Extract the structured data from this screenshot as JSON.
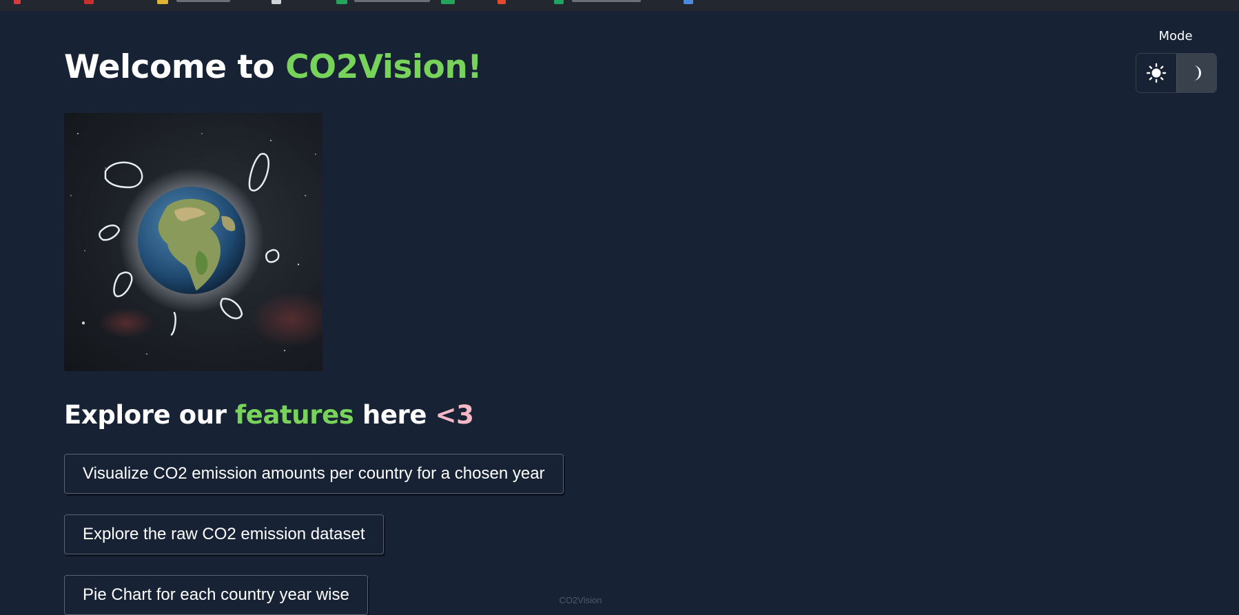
{
  "header": {
    "title_prefix": "Welcome to ",
    "title_brand": "CO2Vision!"
  },
  "mode": {
    "label": "Mode",
    "options": [
      "light",
      "dark"
    ],
    "selected": "dark"
  },
  "hero_image": {
    "icon": "earth-footprints-image"
  },
  "features": {
    "heading_prefix": "Explore our ",
    "heading_highlight": "features",
    "heading_middle": " here ",
    "heading_heart": "<3",
    "buttons": [
      "Visualize CO2 emission amounts per country for a chosen year",
      "Explore the raw CO2 emission dataset",
      "Pie Chart for each country year wise"
    ]
  },
  "footer": {
    "text": "CO2Vision"
  },
  "colors": {
    "background": "#172235",
    "accent_green": "#78d35a",
    "accent_pink": "#f5b8c6"
  }
}
